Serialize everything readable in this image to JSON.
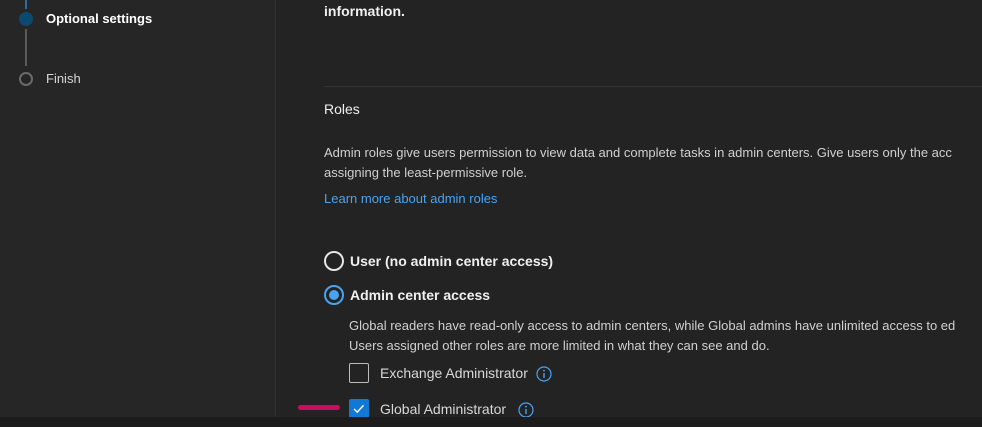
{
  "wizard": {
    "steps": [
      {
        "label": "Optional settings",
        "state": "current"
      },
      {
        "label": "Finish",
        "state": "upcoming"
      }
    ]
  },
  "main": {
    "top_text": "information.",
    "roles": {
      "heading": "Roles",
      "description_line1": "Admin roles give users permission to view data and complete tasks in admin centers. Give users only the acc",
      "description_line2": "assigning the least-permissive role.",
      "learn_more_link": "Learn more about admin roles"
    },
    "access_options": [
      {
        "label": "User (no admin center access)",
        "selected": false
      },
      {
        "label": "Admin center access",
        "selected": true
      }
    ],
    "admin_description_line1": "Global readers have read-only access to admin centers, while Global admins have unlimited access to ed",
    "admin_description_line2": "Users assigned other roles are more limited in what they can see and do.",
    "admin_roles": [
      {
        "label": "Exchange Administrator",
        "checked": false,
        "info_icon": "info-icon"
      },
      {
        "label": "Global Administrator",
        "checked": true,
        "info_icon": "info-icon"
      }
    ]
  },
  "colors": {
    "accent": "#4aa3f0",
    "checkbox_checked": "#1178d4",
    "annotation": "#c4115d",
    "current_step": "#0b4a6e"
  }
}
